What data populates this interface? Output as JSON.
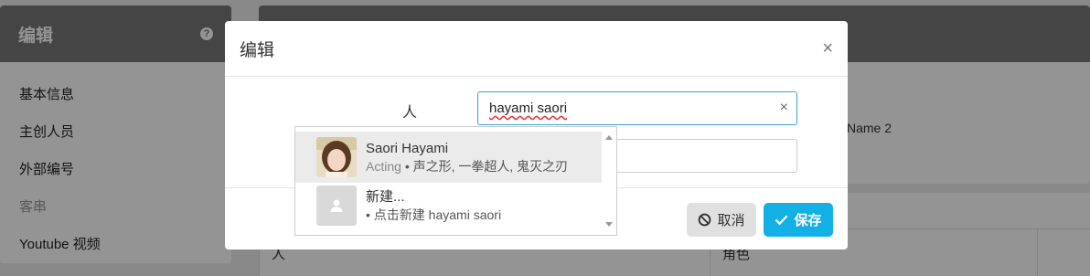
{
  "sidebar": {
    "title": "编辑",
    "help_icon": "?",
    "items": [
      {
        "label": "基本信息"
      },
      {
        "label": "主创人员"
      },
      {
        "label": "外部编号"
      },
      {
        "label": "客串"
      },
      {
        "label": "Youtube 视频"
      }
    ]
  },
  "main": {
    "bg_text": "Name 2",
    "table": {
      "col_person": "人",
      "col_role": "角色"
    }
  },
  "modal": {
    "title": "编辑",
    "close_icon": "×",
    "field_label": "人",
    "search_value": "hayami saori",
    "clear_icon": "×",
    "cancel_label": "取消",
    "save_label": "保存"
  },
  "dropdown": {
    "items": [
      {
        "name": "Saori Hayami",
        "role": "Acting",
        "separator": "•",
        "works": "声之形, 一拳超人, 鬼灭之刃"
      },
      {
        "name": "新建...",
        "separator": "•",
        "works": "点击新建 hayami saori"
      }
    ]
  },
  "colors": {
    "accent": "#12b0e4",
    "header_gray": "#787878",
    "focus_border": "#3aa0d8"
  }
}
